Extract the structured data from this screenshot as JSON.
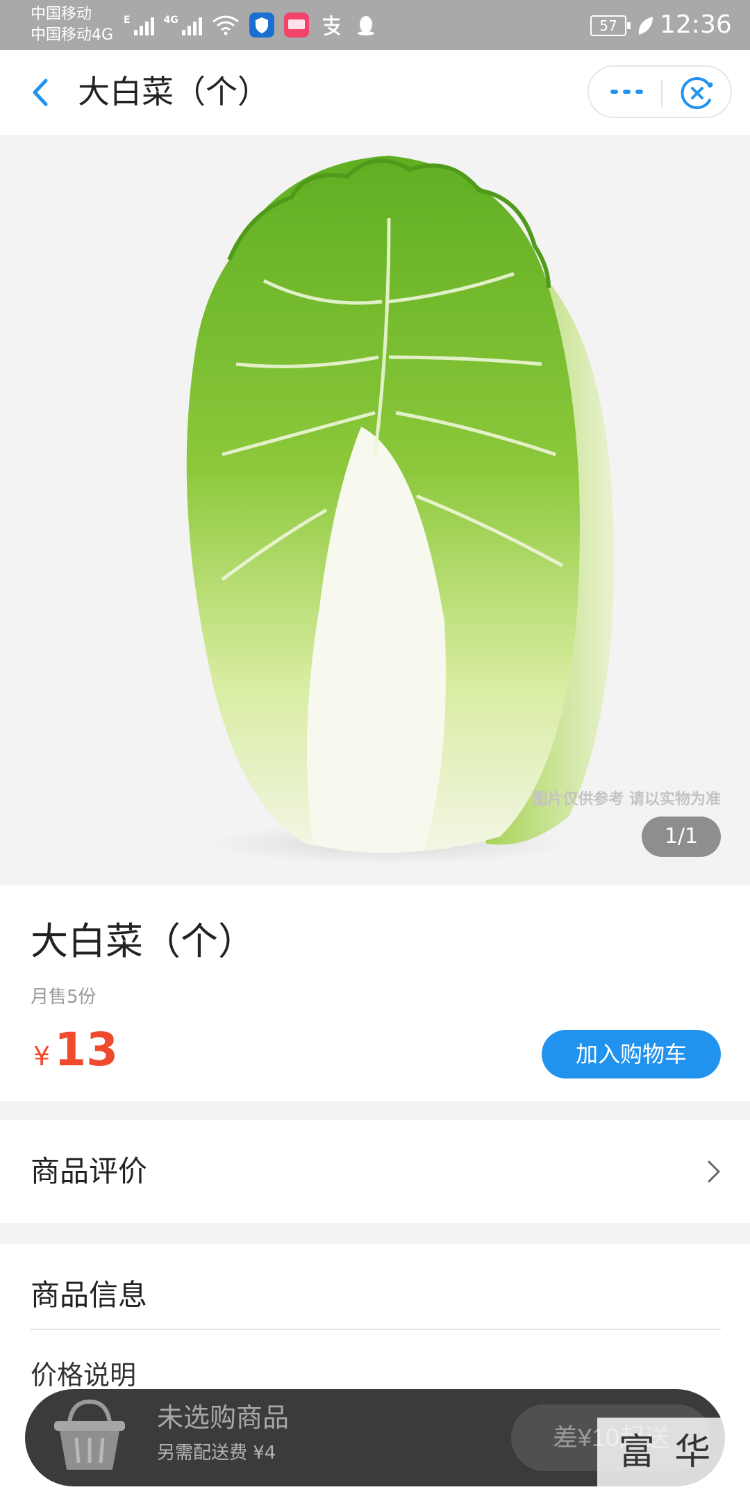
{
  "status_bar": {
    "carrier_1": "中国移动",
    "carrier_2": "中国移动4G",
    "signal_1_tag": "E",
    "signal_2_tag": "4G",
    "battery": "57",
    "time": "12:36",
    "icons": [
      "signal-icon",
      "wifi-icon",
      "shield-app-icon",
      "pinduoduo-app-icon",
      "alipay-icon",
      "qq-icon",
      "battery-icon",
      "leaf-icon"
    ]
  },
  "nav": {
    "back_icon": "chevron-left-icon",
    "title": "大白菜（个）",
    "more_icon": "more-dots-icon",
    "close_icon": "close-miniprogram-icon"
  },
  "hero": {
    "image": "napa-cabbage-photo",
    "disclaimer": "图片仅供参考 请以实物为准",
    "counter": "1/1"
  },
  "product": {
    "title": "大白菜（个）",
    "monthly_sales": "月售5份",
    "currency": "¥",
    "price": "13",
    "add_to_cart": "加入购物车"
  },
  "reviews": {
    "label": "商品评价"
  },
  "goods_info": {
    "label": "商品信息",
    "price_note": "价格说明"
  },
  "cart_bar": {
    "empty_text": "未选购商品",
    "delivery_fee": "另需配送费 ¥4",
    "min_order": "差¥10起送"
  },
  "watermark": "富 华 网",
  "colors": {
    "accent_blue": "#2193ef",
    "price_red": "#f04a2c",
    "cart_bar": "#3b3b3d",
    "status_bar": "#a9a9a9"
  }
}
